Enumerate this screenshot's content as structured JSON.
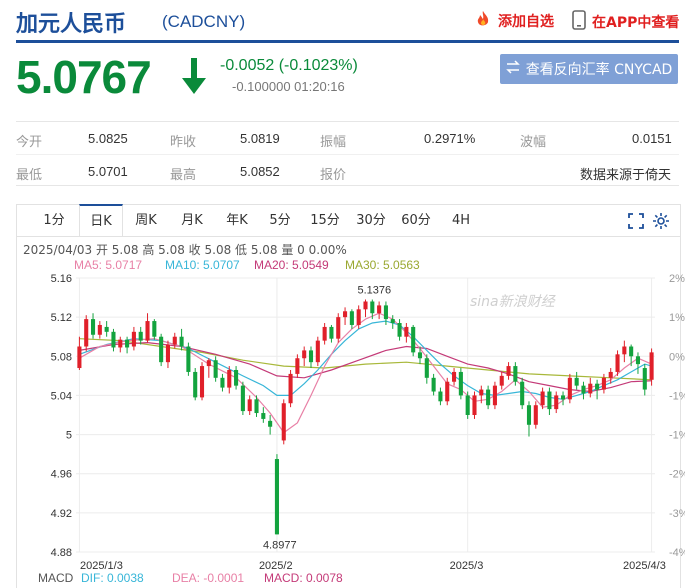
{
  "header": {
    "title": "加元人民币",
    "code": "(CADCNY)",
    "add_watch": "添加自选",
    "open_app": "在APP中查看"
  },
  "quote": {
    "price": "5.0767",
    "change": "-0.0052 (-0.1023%)",
    "sub_info": "-0.100000 01:20:16",
    "reverse_button": "查看反向汇率 CNYCAD"
  },
  "stats": {
    "row1": [
      {
        "label": "今开",
        "value": "5.0825"
      },
      {
        "label": "昨收",
        "value": "5.0819"
      },
      {
        "label": "振幅",
        "value": "0.2971%"
      },
      {
        "label": "波幅",
        "value": "0.0151"
      }
    ],
    "row2": [
      {
        "label": "最低",
        "value": "5.0701"
      },
      {
        "label": "最高",
        "value": "5.0852"
      },
      {
        "label": "报价",
        "value": ""
      },
      {
        "label": "",
        "value": "数据来源于倚天"
      }
    ]
  },
  "tabs": [
    "1分",
    "日K",
    "周K",
    "月K",
    "年K",
    "5分",
    "15分",
    "30分",
    "60分",
    "4H"
  ],
  "active_tab": "日K",
  "chart_info": {
    "ohlc_line": "2025/04/03 开 5.08 高 5.08 收 5.08 低 5.08 量 0 0.00%",
    "ma5": "MA5: 5.0717",
    "ma10": "MA10: 5.0707",
    "ma20": "MA20: 5.0549",
    "ma30": "MA30: 5.0563",
    "watermark": "sina新浪财经"
  },
  "colors": {
    "up": "#e0202a",
    "down": "#13a33e",
    "ma5": "#e880a6",
    "ma10": "#38b6d8",
    "ma20": "#c43a78",
    "ma30": "#a8b83a",
    "brand": "#1d4f9a"
  },
  "macd": {
    "label": "MACD",
    "dif": "DIF: 0.0038",
    "dea": "DEA: -0.0001",
    "macd": "MACD: 0.0078"
  },
  "chart_data": {
    "type": "candlestick",
    "y_ticks": [
      "5.16",
      "5.12",
      "5.08",
      "5.04",
      "5",
      "4.96",
      "4.92",
      "4.88"
    ],
    "pct_ticks": [
      "2%",
      "1%",
      "0%",
      "-1%",
      "-1%",
      "-2%",
      "-3%",
      "-4%"
    ],
    "x_ticks": [
      "2025/1/3",
      "2025/2",
      "2025/3",
      "2025/4/3"
    ],
    "ylim": [
      4.88,
      5.16
    ],
    "annotations": {
      "high": "5.1376",
      "low": "4.8977"
    },
    "candles": [
      [
        5.068,
        5.09,
        5.066,
        5.1
      ],
      [
        5.09,
        5.118,
        5.085,
        5.122
      ],
      [
        5.118,
        5.102,
        5.098,
        5.124
      ],
      [
        5.102,
        5.112,
        5.098,
        5.116
      ],
      [
        5.11,
        5.105,
        5.1,
        5.116
      ],
      [
        5.105,
        5.089,
        5.085,
        5.108
      ],
      [
        5.089,
        5.097,
        5.084,
        5.1
      ],
      [
        5.097,
        5.089,
        5.083,
        5.1
      ],
      [
        5.09,
        5.105,
        5.086,
        5.11
      ],
      [
        5.105,
        5.096,
        5.092,
        5.11
      ],
      [
        5.096,
        5.116,
        5.094,
        5.124
      ],
      [
        5.116,
        5.1,
        5.097,
        5.118
      ],
      [
        5.1,
        5.074,
        5.07,
        5.103
      ],
      [
        5.074,
        5.092,
        5.068,
        5.096
      ],
      [
        5.092,
        5.1,
        5.088,
        5.104
      ],
      [
        5.1,
        5.09,
        5.086,
        5.108
      ],
      [
        5.09,
        5.064,
        5.06,
        5.094
      ],
      [
        5.064,
        5.038,
        5.035,
        5.068
      ],
      [
        5.038,
        5.07,
        5.035,
        5.074
      ],
      [
        5.07,
        5.076,
        5.058,
        5.078
      ],
      [
        5.076,
        5.058,
        5.054,
        5.08
      ],
      [
        5.058,
        5.048,
        5.044,
        5.062
      ],
      [
        5.048,
        5.066,
        5.042,
        5.07
      ],
      [
        5.066,
        5.05,
        5.046,
        5.07
      ],
      [
        5.05,
        5.024,
        5.02,
        5.054
      ],
      [
        5.024,
        5.036,
        5.02,
        5.04
      ],
      [
        5.036,
        5.022,
        5.018,
        5.04
      ],
      [
        5.022,
        5.016,
        5.012,
        5.028
      ],
      [
        5.014,
        5.008,
        5.0,
        5.02
      ],
      [
        4.975,
        4.898,
        4.898,
        4.98
      ],
      [
        4.994,
        5.032,
        4.99,
        5.036
      ],
      [
        5.032,
        5.062,
        5.028,
        5.066
      ],
      [
        5.062,
        5.078,
        5.058,
        5.082
      ],
      [
        5.078,
        5.086,
        5.07,
        5.09
      ],
      [
        5.086,
        5.074,
        5.068,
        5.09
      ],
      [
        5.074,
        5.096,
        5.07,
        5.1
      ],
      [
        5.096,
        5.11,
        5.092,
        5.114
      ],
      [
        5.11,
        5.098,
        5.094,
        5.112
      ],
      [
        5.098,
        5.12,
        5.094,
        5.124
      ],
      [
        5.12,
        5.126,
        5.112,
        5.13
      ],
      [
        5.126,
        5.112,
        5.108,
        5.128
      ],
      [
        5.112,
        5.128,
        5.108,
        5.132
      ],
      [
        5.128,
        5.136,
        5.12,
        5.138
      ],
      [
        5.136,
        5.124,
        5.118,
        5.138
      ],
      [
        5.124,
        5.132,
        5.118,
        5.136
      ],
      [
        5.132,
        5.118,
        5.112,
        5.136
      ],
      [
        5.118,
        5.114,
        5.108,
        5.122
      ],
      [
        5.114,
        5.1,
        5.096,
        5.118
      ],
      [
        5.1,
        5.11,
        5.094,
        5.114
      ],
      [
        5.11,
        5.084,
        5.08,
        5.112
      ],
      [
        5.084,
        5.078,
        5.072,
        5.09
      ],
      [
        5.078,
        5.058,
        5.052,
        5.082
      ],
      [
        5.058,
        5.044,
        5.04,
        5.062
      ],
      [
        5.044,
        5.034,
        5.03,
        5.048
      ],
      [
        5.034,
        5.054,
        5.03,
        5.058
      ],
      [
        5.054,
        5.064,
        5.05,
        5.068
      ],
      [
        5.064,
        5.04,
        5.036,
        5.068
      ],
      [
        5.04,
        5.02,
        5.016,
        5.044
      ],
      [
        5.02,
        5.04,
        5.016,
        5.044
      ],
      [
        5.04,
        5.046,
        5.032,
        5.05
      ],
      [
        5.046,
        5.03,
        5.026,
        5.05
      ],
      [
        5.03,
        5.05,
        5.026,
        5.054
      ],
      [
        5.05,
        5.06,
        5.046,
        5.064
      ],
      [
        5.06,
        5.07,
        5.056,
        5.074
      ],
      [
        5.07,
        5.054,
        5.05,
        5.074
      ],
      [
        5.054,
        5.03,
        5.026,
        5.058
      ],
      [
        5.03,
        5.01,
        4.998,
        5.034
      ],
      [
        5.01,
        5.03,
        5.006,
        5.034
      ],
      [
        5.03,
        5.044,
        5.026,
        5.048
      ],
      [
        5.044,
        5.026,
        5.02,
        5.048
      ],
      [
        5.026,
        5.04,
        5.022,
        5.044
      ],
      [
        5.04,
        5.036,
        5.03,
        5.044
      ],
      [
        5.036,
        5.058,
        5.032,
        5.062
      ],
      [
        5.058,
        5.05,
        5.046,
        5.064
      ],
      [
        5.05,
        5.042,
        5.036,
        5.054
      ],
      [
        5.042,
        5.052,
        5.038,
        5.058
      ],
      [
        5.052,
        5.046,
        5.036,
        5.056
      ],
      [
        5.046,
        5.058,
        5.042,
        5.062
      ],
      [
        5.058,
        5.064,
        5.052,
        5.068
      ],
      [
        5.064,
        5.082,
        5.06,
        5.086
      ],
      [
        5.082,
        5.09,
        5.074,
        5.096
      ],
      [
        5.09,
        5.08,
        5.07,
        5.092
      ],
      [
        5.08,
        5.072,
        5.062,
        5.084
      ],
      [
        5.068,
        5.046,
        5.04,
        5.072
      ],
      [
        5.056,
        5.084,
        5.05,
        5.088
      ]
    ],
    "ma5": [
      [
        0,
        5.078
      ],
      [
        3,
        5.09
      ],
      [
        7,
        5.096
      ],
      [
        11,
        5.098
      ],
      [
        15,
        5.09
      ],
      [
        19,
        5.072
      ],
      [
        23,
        5.058
      ],
      [
        26,
        5.038
      ],
      [
        28,
        5.022
      ],
      [
        30,
        5.002
      ],
      [
        32,
        5.012
      ],
      [
        34,
        5.04
      ],
      [
        36,
        5.07
      ],
      [
        38,
        5.094
      ],
      [
        40,
        5.108
      ],
      [
        42,
        5.118
      ],
      [
        44,
        5.124
      ],
      [
        46,
        5.118
      ],
      [
        48,
        5.104
      ],
      [
        50,
        5.088
      ],
      [
        52,
        5.07
      ],
      [
        54,
        5.052
      ],
      [
        56,
        5.046
      ],
      [
        58,
        5.034
      ],
      [
        60,
        5.036
      ],
      [
        62,
        5.044
      ],
      [
        64,
        5.056
      ],
      [
        66,
        5.044
      ],
      [
        68,
        5.028
      ],
      [
        70,
        5.03
      ],
      [
        72,
        5.04
      ],
      [
        74,
        5.046
      ],
      [
        76,
        5.05
      ],
      [
        78,
        5.056
      ],
      [
        80,
        5.068
      ],
      [
        82,
        5.078
      ],
      [
        84,
        5.072
      ]
    ],
    "ma10": [
      [
        0,
        5.082
      ],
      [
        4,
        5.092
      ],
      [
        8,
        5.098
      ],
      [
        12,
        5.096
      ],
      [
        16,
        5.088
      ],
      [
        20,
        5.074
      ],
      [
        24,
        5.06
      ],
      [
        27,
        5.05
      ],
      [
        29,
        5.04
      ],
      [
        31,
        5.04
      ],
      [
        33,
        5.052
      ],
      [
        35,
        5.066
      ],
      [
        37,
        5.082
      ],
      [
        39,
        5.096
      ],
      [
        41,
        5.108
      ],
      [
        43,
        5.114
      ],
      [
        45,
        5.116
      ],
      [
        47,
        5.112
      ],
      [
        49,
        5.1
      ],
      [
        51,
        5.086
      ],
      [
        53,
        5.072
      ],
      [
        55,
        5.06
      ],
      [
        57,
        5.05
      ],
      [
        59,
        5.042
      ],
      [
        61,
        5.04
      ],
      [
        63,
        5.042
      ],
      [
        65,
        5.044
      ],
      [
        67,
        5.042
      ],
      [
        69,
        5.038
      ],
      [
        71,
        5.036
      ],
      [
        73,
        5.04
      ],
      [
        75,
        5.044
      ],
      [
        77,
        5.05
      ],
      [
        79,
        5.056
      ],
      [
        81,
        5.064
      ],
      [
        83,
        5.072
      ],
      [
        84,
        5.07
      ]
    ],
    "ma20": [
      [
        0,
        5.086
      ],
      [
        5,
        5.092
      ],
      [
        10,
        5.094
      ],
      [
        15,
        5.09
      ],
      [
        20,
        5.082
      ],
      [
        25,
        5.072
      ],
      [
        29,
        5.06
      ],
      [
        33,
        5.058
      ],
      [
        37,
        5.066
      ],
      [
        41,
        5.076
      ],
      [
        45,
        5.086
      ],
      [
        48,
        5.09
      ],
      [
        51,
        5.088
      ],
      [
        54,
        5.08
      ],
      [
        57,
        5.072
      ],
      [
        60,
        5.068
      ],
      [
        63,
        5.062
      ],
      [
        66,
        5.054
      ],
      [
        69,
        5.05
      ],
      [
        72,
        5.046
      ],
      [
        75,
        5.044
      ],
      [
        78,
        5.048
      ],
      [
        81,
        5.054
      ],
      [
        84,
        5.055
      ]
    ],
    "ma30": [
      [
        0,
        5.098
      ],
      [
        6,
        5.096
      ],
      [
        12,
        5.09
      ],
      [
        18,
        5.084
      ],
      [
        24,
        5.076
      ],
      [
        30,
        5.07
      ],
      [
        36,
        5.068
      ],
      [
        42,
        5.072
      ],
      [
        48,
        5.074
      ],
      [
        54,
        5.07
      ],
      [
        60,
        5.066
      ],
      [
        66,
        5.062
      ],
      [
        72,
        5.06
      ],
      [
        78,
        5.058
      ],
      [
        84,
        5.056
      ]
    ]
  }
}
